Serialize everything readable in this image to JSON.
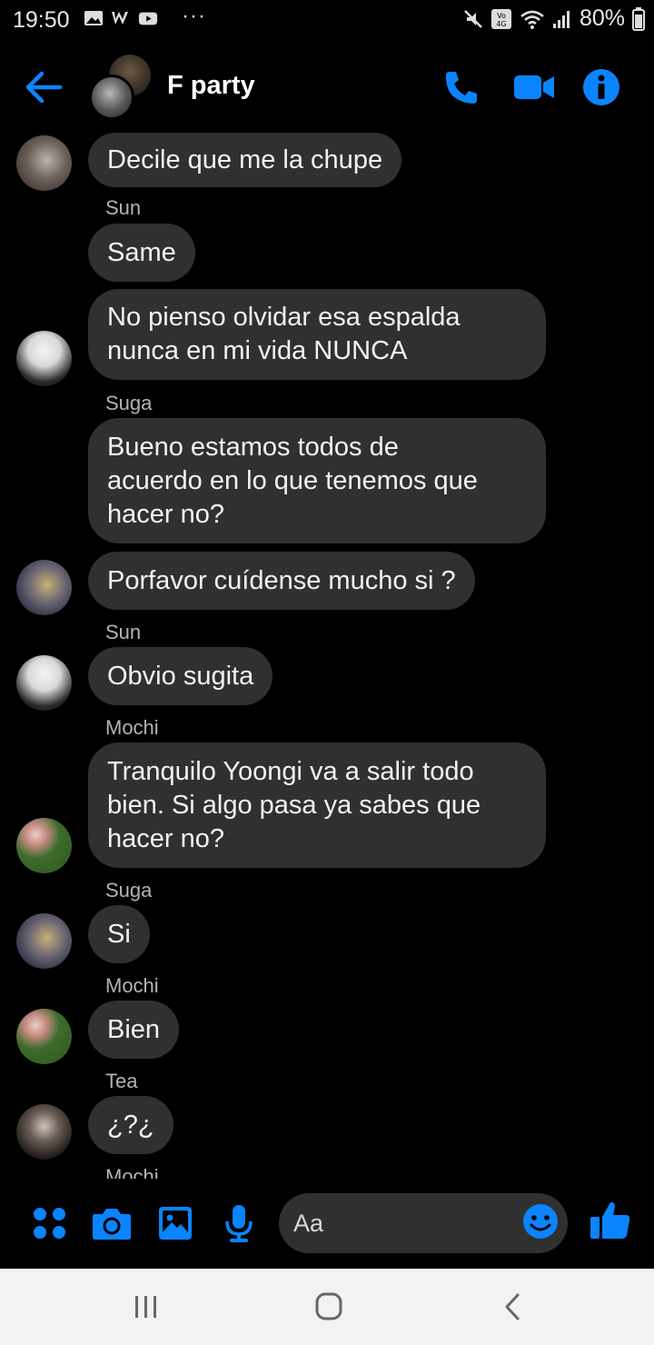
{
  "status_bar": {
    "time": "19:50",
    "overflow": "···",
    "battery": "80%",
    "left_icons": [
      "gallery-icon",
      "w-app-icon",
      "youtube-icon"
    ],
    "right_icons": [
      "mute-icon",
      "volte-4g-icon",
      "wifi-icon",
      "signal-icon",
      "battery-icon"
    ]
  },
  "header": {
    "title": "F party",
    "accent": "#0a84ff"
  },
  "messages": [
    {
      "sender": "",
      "text": "Decile que me la chupe",
      "avatar": true
    },
    {
      "sender": "Sun",
      "text": "Same",
      "avatar": false
    },
    {
      "sender": "",
      "text": "No pienso olvidar esa espalda\nnunca en mi vida NUNCA",
      "avatar": true
    },
    {
      "sender": "Suga",
      "text": "Bueno estamos todos  de\nacuerdo en lo que tenemos que\nhacer no?",
      "avatar": false
    },
    {
      "sender": "",
      "text": "Porfavor cuídense mucho si ?",
      "avatar": true
    },
    {
      "sender": "Sun",
      "text": "Obvio sugita",
      "avatar": true
    },
    {
      "sender": "Mochi",
      "text": "Tranquilo Yoongi va a salir todo\nbien. Si algo pasa ya sabes que\nhacer no?",
      "avatar": true
    },
    {
      "sender": "Suga",
      "text": "Si",
      "avatar": true
    },
    {
      "sender": "Mochi",
      "text": "Bien",
      "avatar": true
    },
    {
      "sender": "Tea",
      "text": "¿?¿",
      "avatar": true
    },
    {
      "sender": "Mochi",
      "text": "",
      "avatar": false
    }
  ],
  "composer": {
    "placeholder": "Aa"
  },
  "colors": {
    "background": "#000000",
    "bubble": "#303030",
    "accent": "#0a84ff",
    "sender_name": "#b0b3b8"
  }
}
